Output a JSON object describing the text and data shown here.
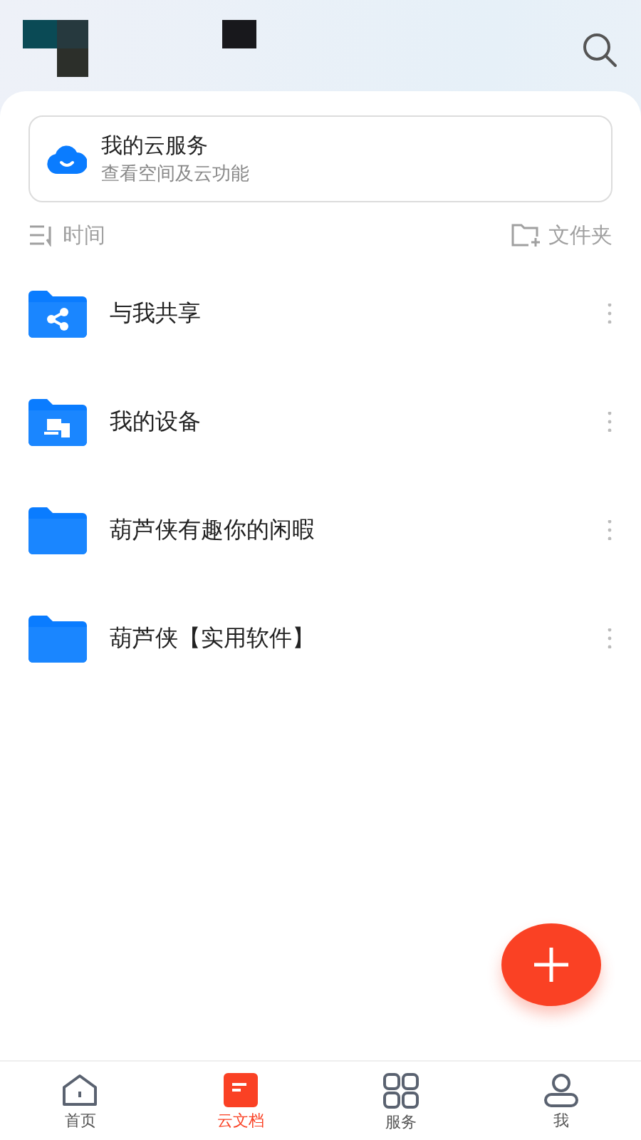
{
  "cloud_service": {
    "title": "我的云服务",
    "subtitle": "查看空间及云功能"
  },
  "toolbar": {
    "sort": "时间",
    "new_folder": "文件夹"
  },
  "folders": [
    {
      "name": "与我共享",
      "kind": "share"
    },
    {
      "name": "我的设备",
      "kind": "device"
    },
    {
      "name": "葫芦侠有趣你的闲暇",
      "kind": "plain"
    },
    {
      "name": "葫芦侠【实用软件】",
      "kind": "plain"
    }
  ],
  "tabs": [
    {
      "label": "首页",
      "kind": "home",
      "selected": false
    },
    {
      "label": "云文档",
      "kind": "docs",
      "selected": true
    },
    {
      "label": "服务",
      "kind": "grid",
      "selected": false
    },
    {
      "label": "我",
      "kind": "user",
      "selected": false
    }
  ]
}
